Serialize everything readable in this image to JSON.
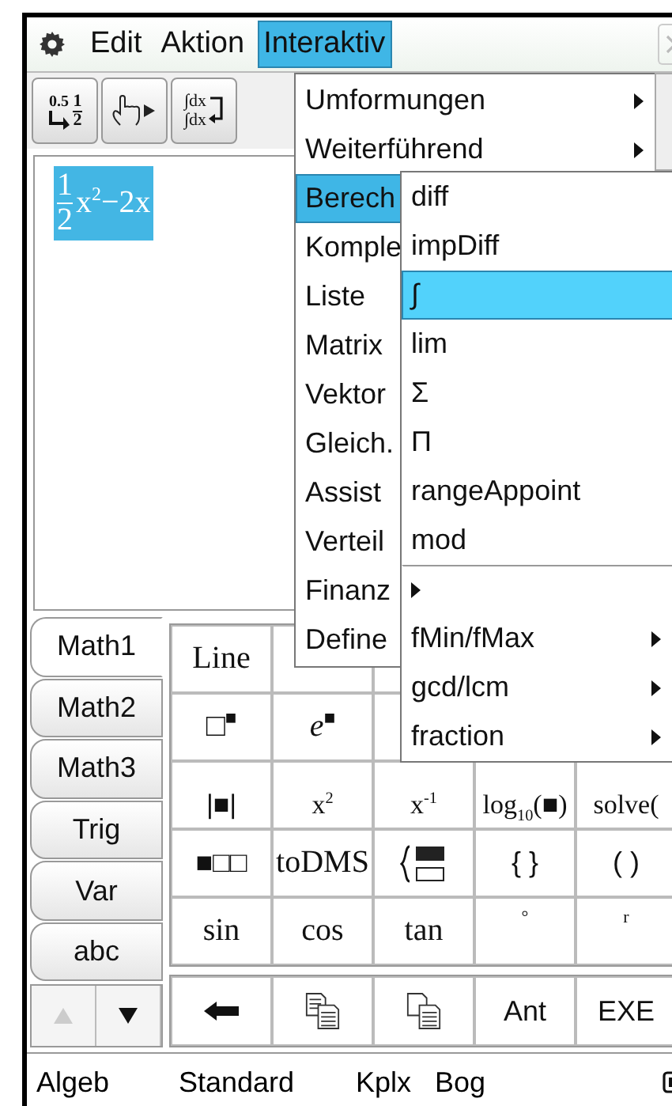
{
  "menubar": {
    "menus": [
      {
        "label": "Edit",
        "selected": false
      },
      {
        "label": "Aktion",
        "selected": false
      },
      {
        "label": "Interaktiv",
        "selected": true
      }
    ]
  },
  "toolbar": {
    "buttons": [
      {
        "kind": "convert",
        "texts": [
          "0.5",
          "1",
          "2"
        ]
      },
      {
        "kind": "pointer"
      },
      {
        "kind": "integral",
        "texts": [
          "∫dx",
          "∫dx"
        ]
      }
    ]
  },
  "work_area": {
    "expression": {
      "fraction": [
        "1",
        "2"
      ],
      "rest": "x$^{2}$−2x",
      "selected": true
    }
  },
  "menu": {
    "items": [
      {
        "label": "Umformungen",
        "submenu": true,
        "selected": false
      },
      {
        "label": "Weiterführend",
        "submenu": true,
        "selected": false
      },
      {
        "label": "Berech",
        "selected": true
      },
      {
        "label": "Komple",
        "selected": false
      },
      {
        "label": "Liste",
        "selected": false
      },
      {
        "label": "Matrix",
        "selected": false
      },
      {
        "label": "Vektor",
        "selected": false
      },
      {
        "label": "Gleich.",
        "selected": false
      },
      {
        "label": "Assist",
        "selected": false
      },
      {
        "label": "Verteil",
        "selected": false
      },
      {
        "label": "Finanz",
        "selected": false
      },
      {
        "label": "Define",
        "selected": false
      }
    ]
  },
  "submenu": {
    "items": [
      {
        "label": "diff",
        "submenu": false,
        "selected": false
      },
      {
        "label": "impDiff",
        "submenu": false,
        "selected": false
      },
      {
        "label": "∫",
        "submenu": false,
        "selected": true
      },
      {
        "label": "lim",
        "submenu": false,
        "selected": false
      },
      {
        "label": "Σ",
        "submenu": false,
        "selected": false
      },
      {
        "label": "Π",
        "submenu": false,
        "selected": false
      },
      {
        "label": "rangeAppoint",
        "submenu": false,
        "selected": false
      },
      {
        "label": "mod",
        "submenu": false,
        "selected": false
      },
      {
        "submenu": true,
        "selected": false,
        "separator": true
      },
      {
        "label": "fMin/fMax",
        "submenu": true,
        "selected": false
      },
      {
        "label": "gcd/lcm",
        "submenu": true,
        "selected": false
      },
      {
        "label": "fraction",
        "submenu": true,
        "selected": false
      }
    ]
  },
  "keyboard": {
    "tabs": [
      {
        "label": "Math1",
        "selected": true
      },
      {
        "label": "Math2",
        "selected": false
      },
      {
        "label": "Math3",
        "selected": false
      },
      {
        "label": "Trig",
        "selected": false
      },
      {
        "label": "Var",
        "selected": false
      },
      {
        "label": "abc",
        "selected": false
      }
    ],
    "scroll": {
      "up_disabled": true,
      "down_disabled": false
    },
    "rows": [
      [
        {
          "kind": "math",
          "label": "Line"
        },
        {
          "kind": "blank"
        },
        {
          "kind": "blank"
        },
        null,
        null
      ],
      [
        {
          "kind": "math",
          "label": "□$^{■}$"
        },
        {
          "kind": "math",
          "label": "*e*$^{■}$"
        },
        {
          "kind": "blank"
        },
        null,
        null
      ],
      [
        {
          "kind": "text",
          "label": "|■|"
        },
        {
          "kind": "math",
          "label": "x$^{2}$"
        },
        {
          "kind": "math",
          "label": "x$^{-1}$"
        },
        {
          "kind": "math",
          "label": "log$_{10}$(■)"
        },
        {
          "kind": "math",
          "label": "solve("
        }
      ],
      [
        {
          "kind": "text",
          "label": "■□□"
        },
        {
          "kind": "math",
          "label": "toDMS"
        },
        {
          "kind": "piecewise"
        },
        {
          "kind": "text",
          "label": "{ }"
        },
        {
          "kind": "text",
          "label": "( )"
        }
      ],
      [
        {
          "kind": "math",
          "label": "sin"
        },
        {
          "kind": "math",
          "label": "cos"
        },
        {
          "kind": "math",
          "label": "tan"
        },
        {
          "kind": "small",
          "label": "°"
        },
        {
          "kind": "small",
          "label": "r"
        }
      ]
    ],
    "bottom_row": [
      {
        "kind": "backspace"
      },
      {
        "kind": "copy"
      },
      {
        "kind": "paste"
      },
      {
        "kind": "text",
        "label": "Ant"
      },
      {
        "kind": "text",
        "label": "EXE"
      }
    ]
  },
  "status_bar": {
    "items": [
      "Algeb",
      "Standard",
      "Kplx",
      "Bog"
    ]
  }
}
